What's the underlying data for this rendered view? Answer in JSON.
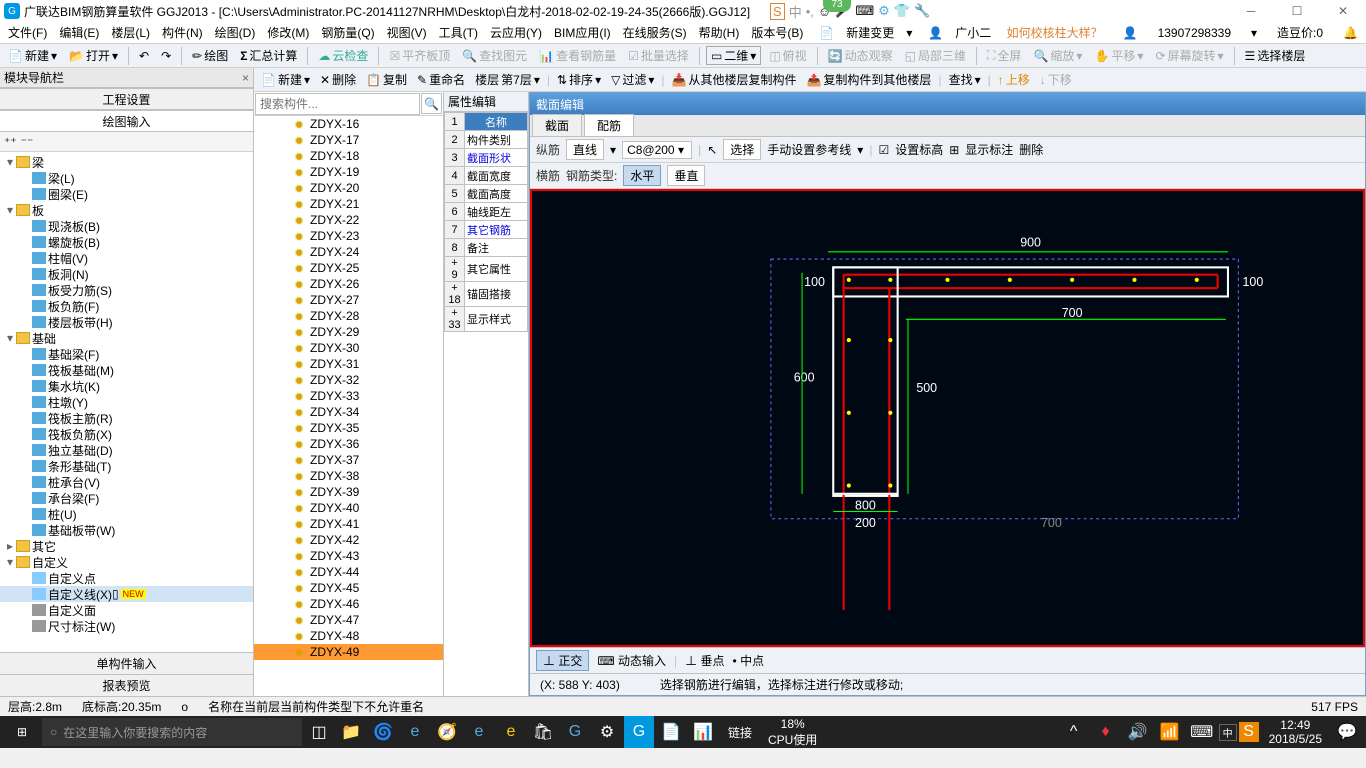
{
  "title": "广联达BIM钢筋算量软件 GGJ2013 - [C:\\Users\\Administrator.PC-20141127NRHM\\Desktop\\白龙村-2018-02-02-19-24-35(2666版).GGJ12]",
  "badge": "73",
  "ime": {
    "zhong": "中",
    "icons": [
      "•,",
      "☺",
      "🎤",
      "⌨",
      "⚙",
      "👕",
      "🔧"
    ]
  },
  "menu": [
    "文件(F)",
    "编辑(E)",
    "楼层(L)",
    "构件(N)",
    "绘图(D)",
    "修改(M)",
    "钢筋量(Q)",
    "视图(V)",
    "工具(T)",
    "云应用(Y)",
    "BIM应用(I)",
    "在线服务(S)",
    "帮助(H)",
    "版本号(B)"
  ],
  "menu_right": {
    "xjbg": "新建变更",
    "gxe": "广小二",
    "help_link": "如何校核柱大样？",
    "user": "13907298339",
    "zdd_lbl": "造豆价:0",
    "zdd_val": ""
  },
  "toolbar1": {
    "xj": "新建",
    "dk": "打开",
    "hf": "绘图",
    "hzjs": "汇总计算",
    "yjc": "云检查",
    "pqbd": "平齐板顶",
    "cztw": "查找图元",
    "ckgj": "查看钢筋量",
    "plxz": "批量选择",
    "ew": "二维",
    "fs": "俯视",
    "dtgc": "动态观察",
    "jbsw": "局部三维",
    "qp": "全屏",
    "sf": "缩放",
    "py": "平移",
    "pmxz": "屏幕旋转",
    "xzlc": "选择楼层"
  },
  "nav": {
    "hdr": "模块导航栏",
    "tab1": "工程设置",
    "tab2": "绘图输入",
    "bot1": "单构件输入",
    "bot2": "报表预览"
  },
  "tree": {
    "liang": "梁",
    "liang_l": "梁(L)",
    "quanliang": "圈梁(E)",
    "ban": "板",
    "xjb": "现浇板(B)",
    "lxb": "螺旋板(B)",
    "zhumao": "柱帽(V)",
    "bandong": "板洞(N)",
    "bslj": "板受力筋(S)",
    "bfj": "板负筋(F)",
    "lcbd": "楼层板带(H)",
    "jichu": "基础",
    "jcl": "基础梁(F)",
    "fbjc": "筏板基础(M)",
    "jsk": "集水坑(K)",
    "zhudun": "柱墩(Y)",
    "fbzj": "筏板主筋(R)",
    "fbfj": "筏板负筋(X)",
    "dljc": "独立基础(D)",
    "txjc": "条形基础(T)",
    "zct": "桩承台(V)",
    "ctl": "承台梁(F)",
    "zhuang": "桩(U)",
    "jcbd": "基础板带(W)",
    "qita": "其它",
    "zdy": "自定义",
    "zdyd": "自定义点",
    "zdyx": "自定义线(X)",
    "zdym": "自定义面",
    "ccbz": "尺寸标注(W)",
    "new": "NEW"
  },
  "midtool": {
    "xj": "新建",
    "sc": "删除",
    "fz": "复制",
    "cmm": "重命名",
    "lc": "楼层",
    "d7c": "第7层",
    "px": "排序",
    "gl": "过滤",
    "cqt": "从其他楼层复制构件",
    "fzd": "复制构件到其他楼层",
    "cz": "查找",
    "sy": "上移",
    "xy": "下移"
  },
  "search_ph": "搜索构件...",
  "items": [
    "ZDYX-16",
    "ZDYX-17",
    "ZDYX-18",
    "ZDYX-19",
    "ZDYX-20",
    "ZDYX-21",
    "ZDYX-22",
    "ZDYX-23",
    "ZDYX-24",
    "ZDYX-25",
    "ZDYX-26",
    "ZDYX-27",
    "ZDYX-28",
    "ZDYX-29",
    "ZDYX-30",
    "ZDYX-31",
    "ZDYX-32",
    "ZDYX-33",
    "ZDYX-34",
    "ZDYX-35",
    "ZDYX-36",
    "ZDYX-37",
    "ZDYX-38",
    "ZDYX-39",
    "ZDYX-40",
    "ZDYX-41",
    "ZDYX-42",
    "ZDYX-43",
    "ZDYX-44",
    "ZDYX-45",
    "ZDYX-46",
    "ZDYX-47",
    "ZDYX-48",
    "ZDYX-49"
  ],
  "prop": {
    "hdr": "属性编辑",
    "rows": [
      {
        "n": "1",
        "l": "名称",
        "hd": true
      },
      {
        "n": "2",
        "l": "构件类别"
      },
      {
        "n": "3",
        "l": "截面形状",
        "blue": true
      },
      {
        "n": "4",
        "l": "截面宽度"
      },
      {
        "n": "5",
        "l": "截面高度"
      },
      {
        "n": "6",
        "l": "轴线距左"
      },
      {
        "n": "7",
        "l": "其它钢筋",
        "blue": true
      },
      {
        "n": "8",
        "l": "备注"
      },
      {
        "n": "9",
        "l": "其它属性",
        "plus": true
      },
      {
        "n": "18",
        "l": "锚固搭接",
        "plus": true
      },
      {
        "n": "33",
        "l": "显示样式",
        "plus": true
      }
    ]
  },
  "editor": {
    "hdr": "截面编辑",
    "tab1": "截面",
    "tab2": "配筋",
    "zj": "纵筋",
    "zx": "直线",
    "c8": "C8@200",
    "xz": "选择",
    "sdsz": "手动设置参考线",
    "szbg": "设置标高",
    "xsbz": "显示标注",
    "shanchu": "删除",
    "hj": "横筋",
    "gjlx": "钢筋类型:",
    "sp": "水平",
    "sz2": "垂直",
    "zj2": "正交",
    "dtsr": "动态输入",
    "cd": "垂点",
    "zd": "中点",
    "coords": "(X: 588 Y: 403)",
    "hint": "选择钢筋进行编辑，选择标注进行修改或移动;"
  },
  "dims": {
    "d900": "900",
    "d100a": "100",
    "d100b": "100",
    "d700": "700",
    "d600": "600",
    "d500": "500",
    "d800": "800",
    "d200": "200",
    "d700b": "700"
  },
  "status": {
    "ch": "层高:2.8m",
    "dbg": "底标高:20.35m",
    "o": "o",
    "msg": "名称在当前层当前构件类型下不允许重名",
    "fps": "517 FPS"
  },
  "taskbar": {
    "search": "在这里输入你要搜索的内容",
    "lj": "链接",
    "cpu1": "18%",
    "cpu2": "CPU使用",
    "time": "12:49",
    "date": "2018/5/25"
  }
}
